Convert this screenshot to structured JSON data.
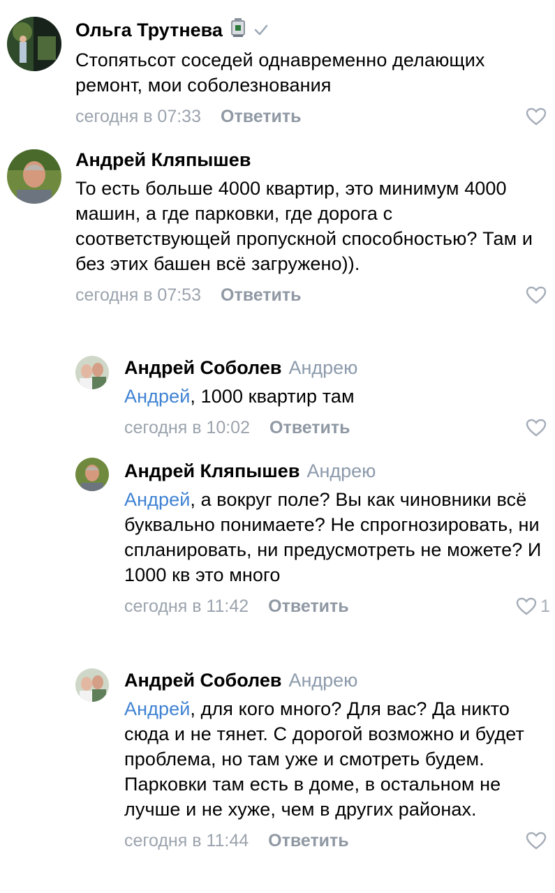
{
  "comments": [
    {
      "author": "Ольга Трутнева",
      "text": "Стопятьсот соседей однавременно делающих ремонт, мои соболезнования",
      "time": "сегодня в 07:33",
      "reply_label": "Ответить",
      "likes": ""
    },
    {
      "author": "Андрей Кляпышев",
      "text": "То есть больше 4000 квартир, это минимум 4000 машин, а где парковки, где дорога с соответствующей пропускной способностью? Там и без этих башен всё загружено)).",
      "time": "сегодня в 07:53",
      "reply_label": "Ответить",
      "likes": ""
    },
    {
      "author": "Андрей Соболев",
      "reply_to": "Андрею",
      "mention": "Андрей",
      "text": ", 1000 квартир там",
      "time": "сегодня в 10:02",
      "reply_label": "Ответить",
      "likes": ""
    },
    {
      "author": "Андрей Кляпышев",
      "reply_to": "Андрею",
      "mention": "Андрей",
      "text": ", а вокруг поле? Вы как чиновники всё буквально понимаете? Не спрогнозировать, ни спланировать, ни предусмотреть не можете? И 1000 кв это много",
      "time": "сегодня в 11:42",
      "reply_label": "Ответить",
      "likes": "1"
    },
    {
      "author": "Андрей Соболев",
      "reply_to": "Андрею",
      "mention": "Андрей",
      "text": ", для кого много? Для вас? Да никто сюда и не тянет. С дорогой возможно и будет проблема, но там уже и смотреть будем. Парковки там есть в доме, в остальном не лучше и не хуже, чем в других районах.",
      "time": "сегодня в 11:44",
      "reply_label": "Ответить",
      "likes": ""
    }
  ],
  "colors": {
    "mention": "#3f82d3",
    "meta": "#9ba3ad",
    "reply_to": "#8c9aab",
    "verified": "#9aa6b5"
  },
  "icons": [
    "coffee-machine-badge-icon",
    "verified-check-icon",
    "heart-icon"
  ]
}
